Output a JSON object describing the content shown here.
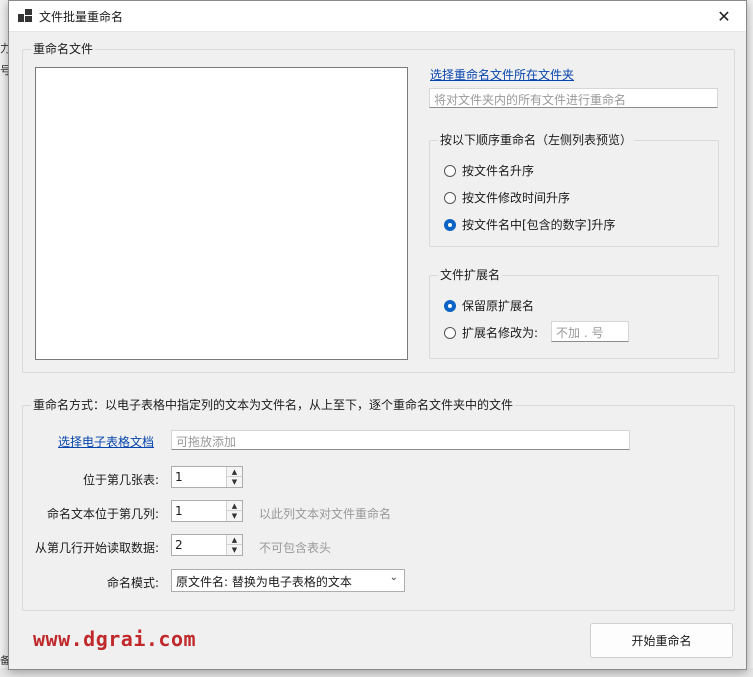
{
  "background": {
    "left_glyph_1": "力",
    "left_glyph_2": "号",
    "bottom_glyph": "备"
  },
  "window": {
    "title": "文件批量重命名",
    "close_glyph": "✕"
  },
  "files_group": {
    "label": "重命名文件",
    "select_folder_link": "选择重命名文件所在文件夹",
    "folder_placeholder": "将对文件夹内的所有文件进行重命名"
  },
  "order_group": {
    "label": "按以下顺序重命名（左侧列表预览）",
    "options": [
      {
        "label": "按文件名升序",
        "checked": false
      },
      {
        "label": "按文件修改时间升序",
        "checked": false
      },
      {
        "label": "按文件名中[包含的数字]升序",
        "checked": true
      }
    ]
  },
  "ext_group": {
    "label": "文件扩展名",
    "keep_label": "保留原扩展名",
    "keep_checked": true,
    "change_label": "扩展名修改为:",
    "change_checked": false,
    "ext_placeholder": "不加 . 号"
  },
  "method_group": {
    "label": "重命名方式：以电子表格中指定列的文本为文件名，从上至下，逐个重命名文件夹中的文件",
    "select_sheet_link": "选择电子表格文档",
    "sheet_placeholder": "可拖放添加",
    "sheet_index_label": "位于第几张表:",
    "sheet_index_value": "1",
    "column_label": "命名文本位于第几列:",
    "column_value": "1",
    "column_hint": "以此列文本对文件重命名",
    "start_row_label": "从第几行开始读取数据:",
    "start_row_value": "2",
    "start_row_hint": "不可包含表头",
    "mode_label": "命名模式:",
    "mode_value": "原文件名: 替换为电子表格的文本"
  },
  "footer": {
    "watermark": "www.dgrai.com",
    "start_button": "开始重命名"
  },
  "colors": {
    "accent": "#0b63c5",
    "link": "#0645ad",
    "watermark": "#c0292b",
    "dialog_bg": "#f0f0f0"
  }
}
